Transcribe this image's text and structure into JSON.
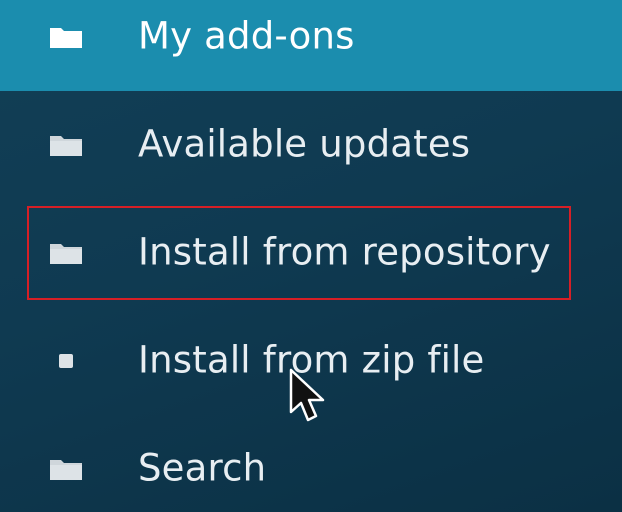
{
  "menu": {
    "items": [
      {
        "label": "My add-ons",
        "icon": "folder-icon",
        "selected": true
      },
      {
        "label": "Available updates",
        "icon": "folder-icon"
      },
      {
        "label": "Install from repository",
        "icon": "folder-icon",
        "highlighted": true
      },
      {
        "label": "Install from zip file",
        "icon": "square-icon"
      },
      {
        "label": "Search",
        "icon": "folder-icon"
      }
    ]
  },
  "colors": {
    "background": "#0f3a51",
    "selected_background": "#1b8dae",
    "highlight_border": "#d61f26",
    "text": "#e8eef2"
  }
}
